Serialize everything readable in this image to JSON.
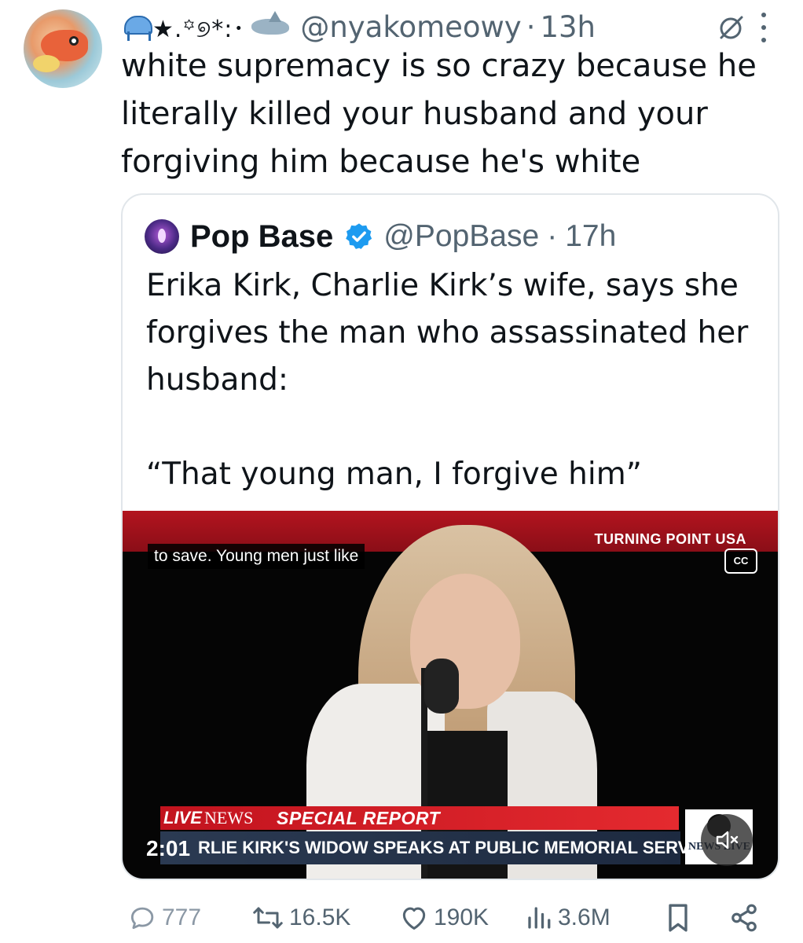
{
  "tweet": {
    "display_name": "★.꙳୭*:･",
    "handle": "@nyakomeowy",
    "separator": "·",
    "time": "13h",
    "text": "white supremacy is so crazy because he literally killed your husband and your forgiving him because he's white"
  },
  "quote": {
    "name": "Pop Base",
    "handle": "@PopBase",
    "separator": "·",
    "time": "17h",
    "text": "Erika Kirk, Charlie Kirk’s wife, says she forgives the man who assassinated her husband:\n\n“That young man, I forgive him”",
    "video": {
      "caption": "to save. Young men just like",
      "logo_text": "TURNING POINT USA",
      "cc_label": "CC",
      "live_label": "LIVE",
      "news_label": "NEWS",
      "special_report": "SPECIAL REPORT",
      "headline": "RLIE KIRK'S WIDOW SPEAKS AT PUBLIC MEMORIAL SERVICE",
      "timestamp": "2:01",
      "corner_logo": "NEWS LIVE"
    }
  },
  "actions": {
    "replies": "777",
    "reposts": "16.5K",
    "likes": "190K",
    "views": "3.6M"
  },
  "colors": {
    "text_primary": "#0f1419",
    "text_secondary": "#536471",
    "verified_blue": "#1d9bf0",
    "border": "#e1e6ea"
  }
}
